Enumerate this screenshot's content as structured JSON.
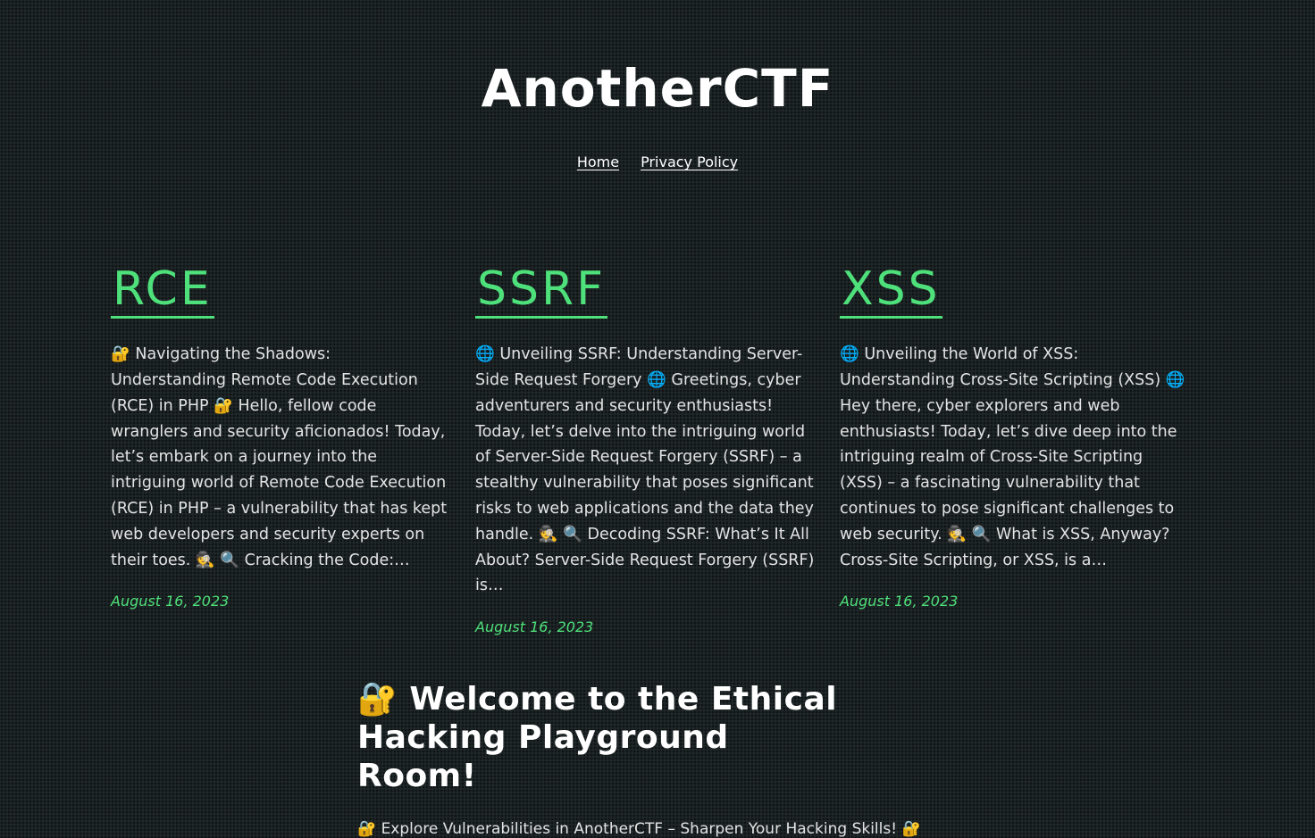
{
  "site": {
    "title": "AnotherCTF"
  },
  "nav": {
    "items": [
      "Home",
      "Privacy Policy"
    ]
  },
  "posts": [
    {
      "title": "RCE",
      "excerpt": "🔐 Navigating the Shadows: Understanding Remote Code Execution (RCE) in PHP 🔐 Hello, fellow code wranglers and security aficionados! Today, let’s embark on a journey into the intriguing world of Remote Code Execution (RCE) in PHP – a vulnerability that has kept web developers and security experts on their toes. 🕵️ 🔍 Cracking the Code:…",
      "date": "August 16, 2023"
    },
    {
      "title": "SSRF",
      "excerpt": "🌐 Unveiling SSRF: Understanding Server-Side Request Forgery 🌐 Greetings, cyber adventurers and security enthusiasts! Today, let’s delve into the intriguing world of Server-Side Request Forgery (SSRF) – a stealthy vulnerability that poses significant risks to web applications and the data they handle. 🕵️ 🔍 Decoding SSRF: What’s It All About? Server-Side Request Forgery (SSRF) is…",
      "date": "August 16, 2023"
    },
    {
      "title": "XSS",
      "excerpt": "🌐 Unveiling the World of XSS: Understanding Cross-Site Scripting (XSS) 🌐 Hey there, cyber explorers and web enthusiasts! Today, let’s dive deep into the intriguing realm of Cross-Site Scripting (XSS) – a fascinating vulnerability that continues to pose significant challenges to web security. 🕵️ 🔍 What is XSS, Anyway? Cross-Site Scripting, or XSS, is a…",
      "date": "August 16, 2023"
    }
  ],
  "welcome": {
    "heading": "🔐 Welcome to the Ethical Hacking Playground Room!",
    "subtext": "🔐 Explore Vulnerabilities in AnotherCTF – Sharpen Your Hacking Skills! 🔐"
  },
  "colors": {
    "background": "#1b2224",
    "accent": "#4ee07a",
    "text": "#e3e3e3"
  }
}
